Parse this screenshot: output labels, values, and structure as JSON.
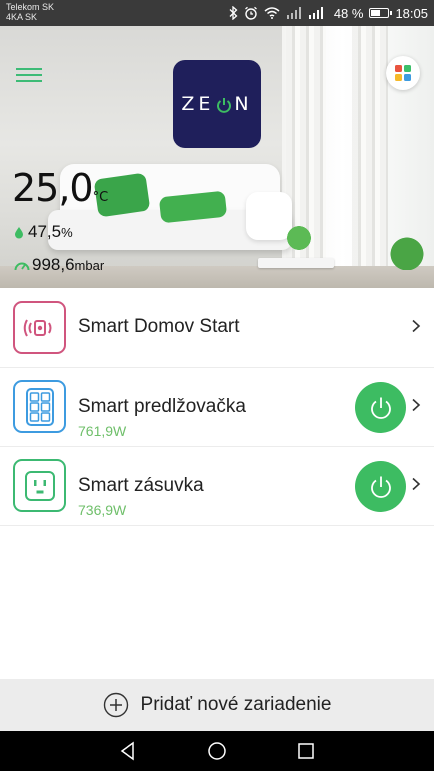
{
  "status_bar": {
    "carrier_line1": "Telekom SK",
    "carrier_line2": "4KA SK",
    "battery_text": "48 %",
    "battery_level": 0.48,
    "time": "18:05"
  },
  "header": {
    "logo_text_left": "ZE",
    "logo_text_right": "N",
    "menu_icon": "hamburger-icon",
    "apps_icon": "apps-grid-icon",
    "apps_colors": [
      "#e9543f",
      "#3cbf6a",
      "#f6b929",
      "#3d9be0"
    ]
  },
  "sensors": {
    "temperature": "25,0",
    "temperature_unit": "°C",
    "humidity": "47,5",
    "humidity_unit": "%",
    "pressure": "998,6",
    "pressure_unit": "mbar"
  },
  "devices": [
    {
      "name": "Smart Domov Start",
      "power": "",
      "icon": "smart-hub-icon",
      "color": "#d0557e",
      "has_toggle": false
    },
    {
      "name": "Smart predlžovačka",
      "power": "761,9W",
      "icon": "power-strip-icon",
      "color": "#3d9be0",
      "has_toggle": true
    },
    {
      "name": "Smart zásuvka",
      "power": "736,9W",
      "icon": "smart-socket-icon",
      "color": "#3cb972",
      "has_toggle": true
    }
  ],
  "add_device": {
    "label": "Pridať nové zariadenie",
    "icon": "add-circle-icon"
  },
  "accent": "#3dbc62"
}
